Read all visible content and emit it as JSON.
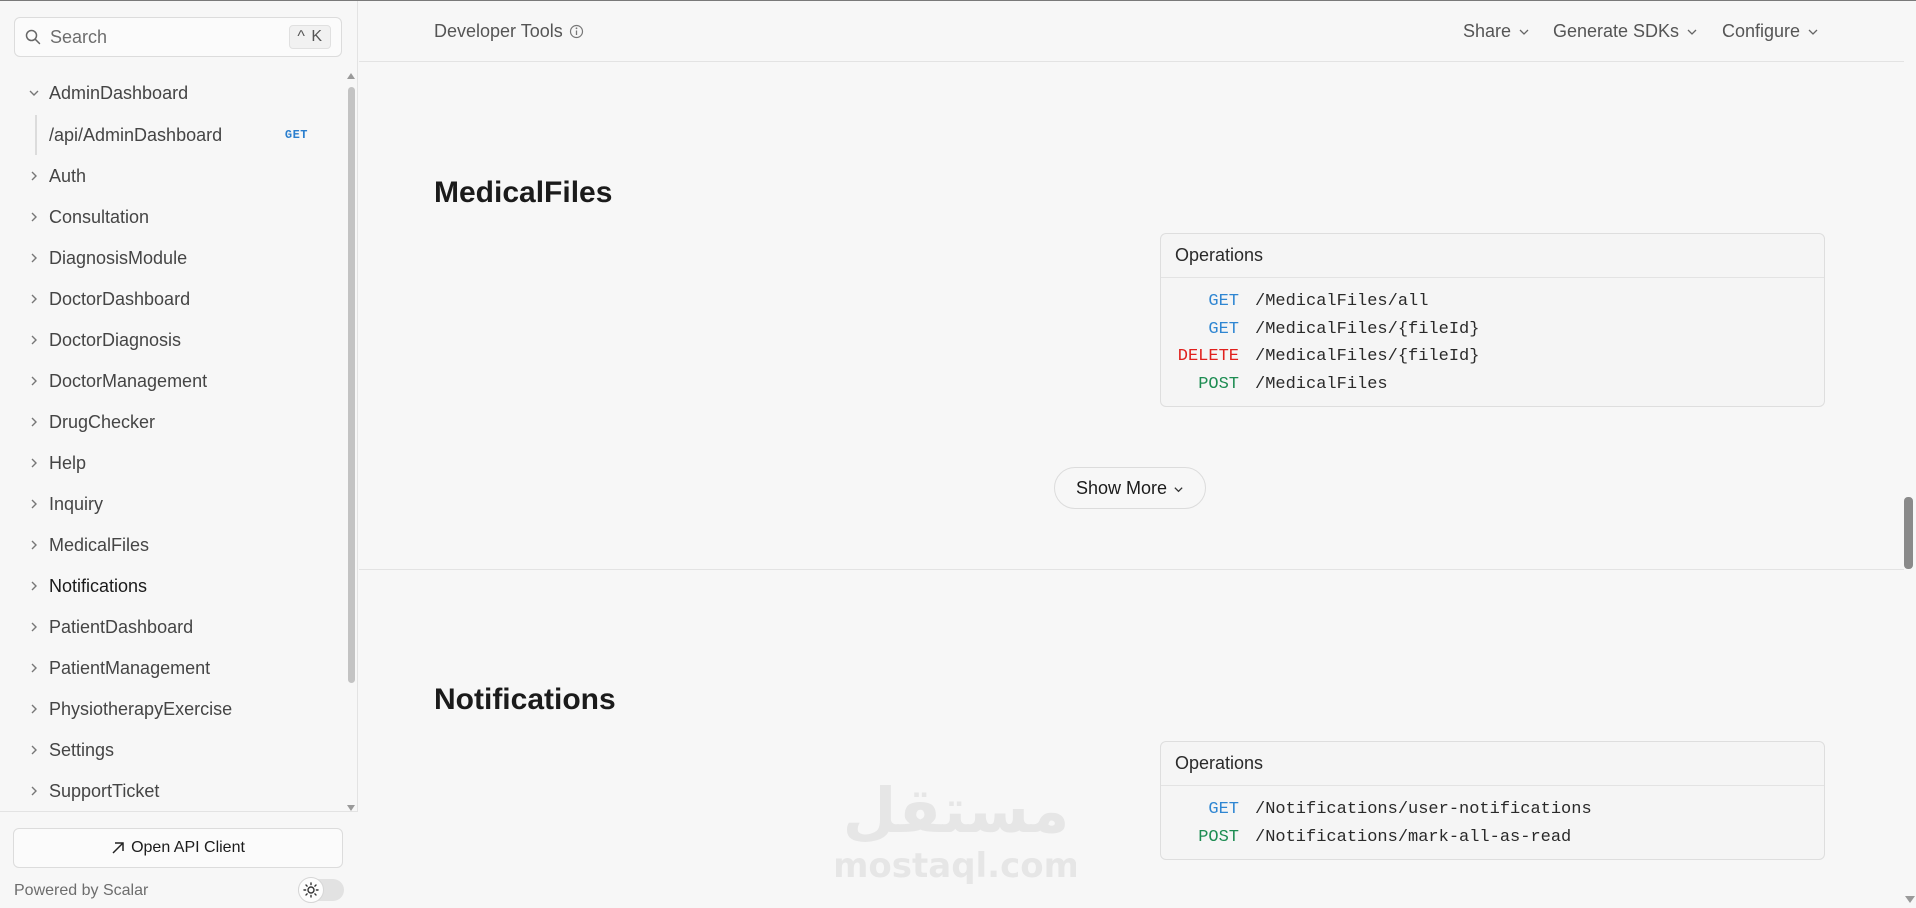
{
  "search": {
    "placeholder": "Search",
    "shortcut": "^ K"
  },
  "sidebar": {
    "items": [
      {
        "label": "AdminDashboard",
        "expanded": true
      },
      {
        "label": "Auth"
      },
      {
        "label": "Consultation"
      },
      {
        "label": "DiagnosisModule"
      },
      {
        "label": "DoctorDashboard"
      },
      {
        "label": "DoctorDiagnosis"
      },
      {
        "label": "DoctorManagement"
      },
      {
        "label": "DrugChecker"
      },
      {
        "label": "Help"
      },
      {
        "label": "Inquiry"
      },
      {
        "label": "MedicalFiles"
      },
      {
        "label": "Notifications",
        "active": true
      },
      {
        "label": "PatientDashboard"
      },
      {
        "label": "PatientManagement"
      },
      {
        "label": "PhysiotherapyExercise"
      },
      {
        "label": "Settings"
      },
      {
        "label": "SupportTicket"
      }
    ],
    "sub_item": {
      "label": "/api/AdminDashboard",
      "method": "GET"
    },
    "open_client_label": "Open API Client",
    "powered_by": "Powered by Scalar"
  },
  "header": {
    "title": "Developer Tools",
    "menus": [
      "Share",
      "Generate SDKs",
      "Configure"
    ]
  },
  "sections": [
    {
      "title": "MedicalFiles",
      "ops_title": "Operations",
      "operations": [
        {
          "method": "GET",
          "path": "/MedicalFiles/all"
        },
        {
          "method": "GET",
          "path": "/MedicalFiles/{fileId}"
        },
        {
          "method": "DELETE",
          "path": "/MedicalFiles/{fileId}"
        },
        {
          "method": "POST",
          "path": "/MedicalFiles"
        }
      ],
      "show_more": "Show More"
    },
    {
      "title": "Notifications",
      "ops_title": "Operations",
      "operations": [
        {
          "method": "GET",
          "path": "/Notifications/user-notifications"
        },
        {
          "method": "POST",
          "path": "/Notifications/mark-all-as-read"
        }
      ]
    }
  ],
  "watermark": {
    "arabic": "مستقل",
    "latin": "mostaql.com"
  },
  "colors": {
    "get": "#2f86d2",
    "delete": "#e0201d",
    "post": "#1d8c52",
    "background": "#f7f7f7"
  }
}
